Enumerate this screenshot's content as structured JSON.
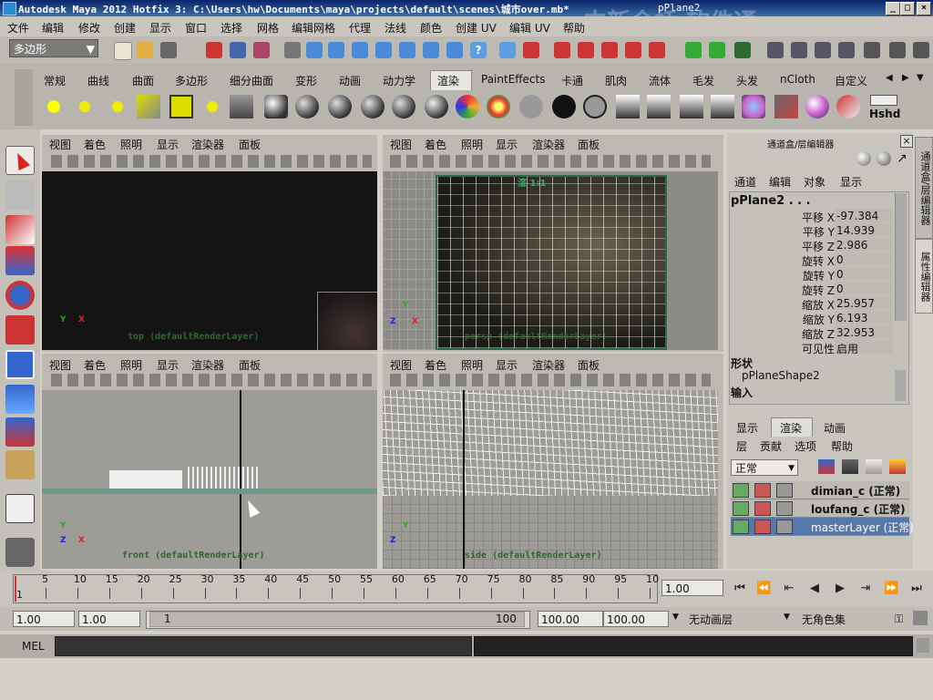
{
  "window": {
    "title": "Autodesk Maya 2012 Hotfix 3: C:\\Users\\hw\\Documents\\maya\\projects\\default\\scenes\\城市over.mb*",
    "object": "pPlane2",
    "watermark": "中新金桥 软件通"
  },
  "menubar": [
    "文件",
    "编辑",
    "修改",
    "创建",
    "显示",
    "窗口",
    "选择",
    "网格",
    "编辑网格",
    "代理",
    "法线",
    "颜色",
    "创建 UV",
    "编辑 UV",
    "帮助"
  ],
  "status": {
    "mode": "多边形"
  },
  "shelf": {
    "tabs": [
      "常规",
      "曲线",
      "曲面",
      "多边形",
      "细分曲面",
      "变形",
      "动画",
      "动力学",
      "渲染",
      "PaintEffects",
      "卡通",
      "肌肉",
      "流体",
      "毛发",
      "头发",
      "nCloth",
      "自定义"
    ],
    "active": "渲染",
    "last_icon_label": "Hshd"
  },
  "viewports": {
    "menu": [
      "视图",
      "着色",
      "照明",
      "显示",
      "渲染器",
      "面板"
    ],
    "top": {
      "label": "top (defaultRenderLayer)"
    },
    "persp": {
      "label": "persp (defaultRenderLayer)",
      "overlay_text": "渲 1:1"
    },
    "front": {
      "label": "front (defaultRenderLayer)"
    },
    "side": {
      "label": "side (defaultRenderLayer)"
    },
    "axes": {
      "x": "X",
      "y": "Y",
      "z": "Z"
    }
  },
  "channel_box": {
    "title": "通道盒/层编辑器",
    "menu": [
      "通道",
      "编辑",
      "对象",
      "显示"
    ],
    "object": "pPlane2 . . .",
    "attributes": [
      {
        "label": "平移 X",
        "value": "-97.384"
      },
      {
        "label": "平移 Y",
        "value": "14.939"
      },
      {
        "label": "平移 Z",
        "value": "2.986"
      },
      {
        "label": "旋转 X",
        "value": "0"
      },
      {
        "label": "旋转 Y",
        "value": "0"
      },
      {
        "label": "旋转 Z",
        "value": "0"
      },
      {
        "label": "缩放 X",
        "value": "25.957"
      },
      {
        "label": "缩放 Y",
        "value": "6.193"
      },
      {
        "label": "缩放 Z",
        "value": "32.953"
      },
      {
        "label": "可见性",
        "value": "启用"
      }
    ],
    "shapes_header": "形状",
    "shape": "pPlaneShape2",
    "inputs_header": "输入",
    "side_tabs": [
      "通道盒/层编辑器",
      "属性编辑器"
    ]
  },
  "layer_editor": {
    "tabs": [
      "显示",
      "渲染",
      "动画"
    ],
    "active_tab": "渲染",
    "menu": [
      "层",
      "贡献",
      "选项",
      "帮助"
    ],
    "blend_mode": "正常",
    "layers": [
      {
        "name": "dimian_c (正常)",
        "selected": false
      },
      {
        "name": "loufang_c (正常)",
        "selected": false
      },
      {
        "name": "masterLayer (正常)",
        "selected": true
      }
    ]
  },
  "timeline": {
    "ticks": [
      "5",
      "10",
      "15",
      "20",
      "25",
      "30",
      "35",
      "40",
      "45",
      "50",
      "55",
      "60",
      "65",
      "70",
      "75",
      "80",
      "85",
      "90",
      "95",
      "10"
    ],
    "start_label": "1",
    "current_frame": "1.00",
    "playback_icons": [
      "go-start-icon",
      "step-back-icon",
      "prev-key-icon",
      "play-back-icon",
      "play-forward-icon",
      "next-key-icon",
      "step-forward-icon",
      "go-end-icon"
    ]
  },
  "range": {
    "start": "1.00",
    "anim_start": "1.00",
    "slider_start": "1",
    "slider_end": "100",
    "end": "100.00",
    "anim_end": "100.00",
    "anim_layer": "无动画层",
    "char_set": "无角色集"
  },
  "command": {
    "label": "MEL"
  }
}
